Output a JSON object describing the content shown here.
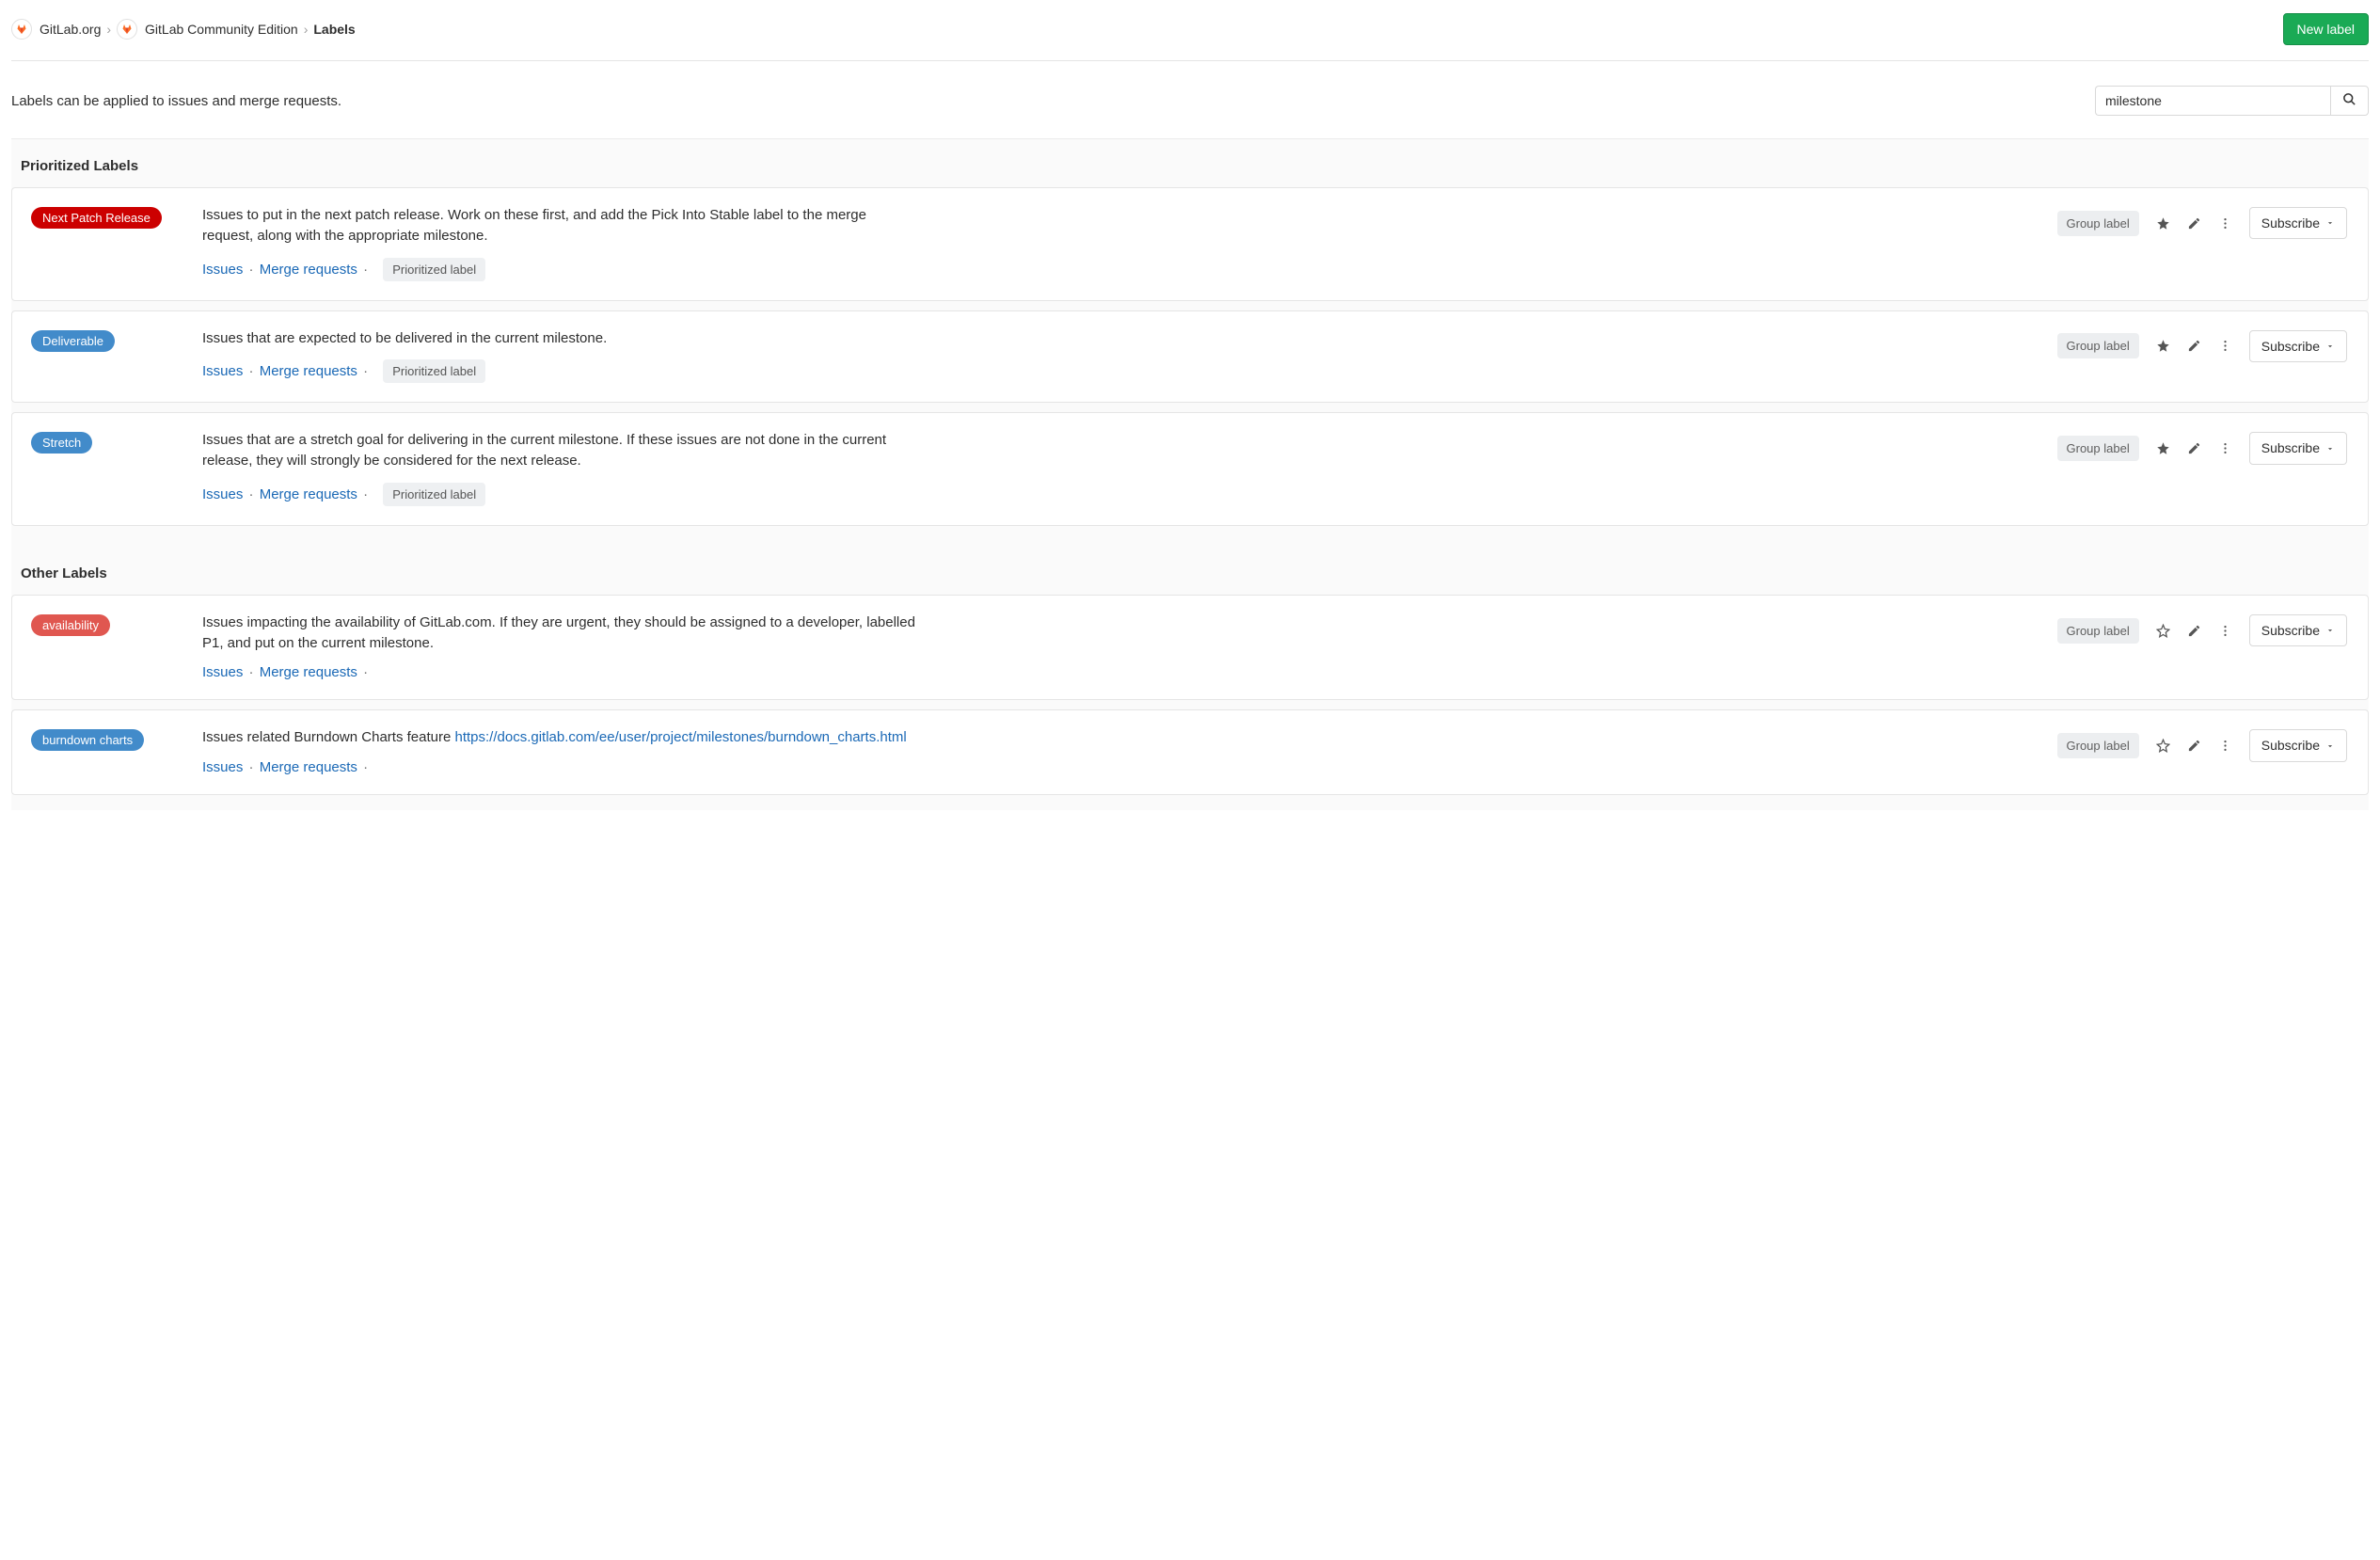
{
  "breadcrumb": {
    "org": "GitLab.org",
    "project": "GitLab Community Edition",
    "page": "Labels"
  },
  "new_label_button": "New label",
  "intro_text": "Labels can be applied to issues and merge requests.",
  "search": {
    "value": "milestone"
  },
  "sections": {
    "prioritized_title": "Prioritized Labels",
    "other_title": "Other Labels"
  },
  "common": {
    "group_label": "Group label",
    "issues": "Issues",
    "merge_requests": "Merge requests",
    "prioritized_chip": "Prioritized label",
    "subscribe": "Subscribe"
  },
  "prioritized": [
    {
      "name": "Next Patch Release",
      "color": "#cc0000",
      "description": "Issues to put in the next patch release. Work on these first, and add the Pick Into Stable label to the merge request, along with the appropriate milestone.",
      "star_filled": true
    },
    {
      "name": "Deliverable",
      "color": "#428bca",
      "description": "Issues that are expected to be delivered in the current milestone.",
      "star_filled": true
    },
    {
      "name": "Stretch",
      "color": "#428bca",
      "description": "Issues that are a stretch goal for delivering in the current milestone. If these issues are not done in the current release, they will strongly be considered for the next release.",
      "star_filled": true
    }
  ],
  "other": [
    {
      "name": "availability",
      "color": "#e05750",
      "description": "Issues impacting the availability of GitLab.com. If they are urgent, they should be assigned to a developer, labelled P1, and put on the current milestone.",
      "star_filled": false
    },
    {
      "name": "burndown charts",
      "color": "#428bca",
      "description": "Issues related Burndown Charts feature",
      "link": "https://docs.gitlab.com/ee/user/project/milestones/burndown_charts.html",
      "star_filled": false
    }
  ]
}
